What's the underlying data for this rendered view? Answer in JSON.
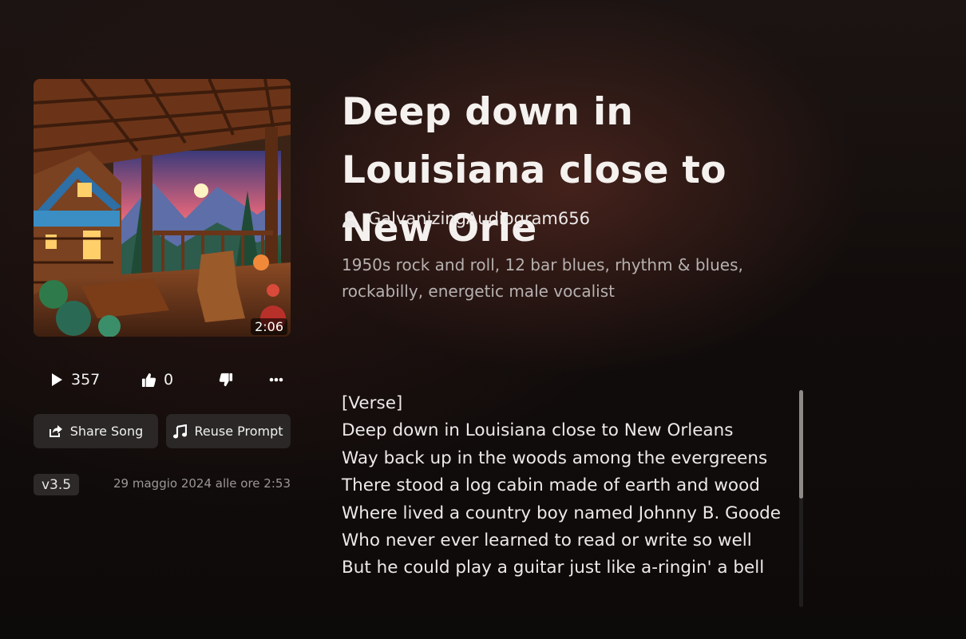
{
  "song": {
    "title": "Deep down in Louisiana close to New Orle",
    "author": "GalvanizingAudiogram656",
    "tags": "1950s rock and roll, 12 bar blues, rhythm & blues, rockabilly, energetic male vocalist",
    "duration": "2:06",
    "cover_icon": "cabin-porch-artwork"
  },
  "stats": {
    "plays": "357",
    "likes": "0"
  },
  "actions": {
    "share_label": "Share Song",
    "reuse_label": "Reuse Prompt"
  },
  "meta": {
    "version": "v3.5",
    "date": "29 maggio 2024 alle ore 2:53"
  },
  "lyrics": [
    "[Verse]",
    "Deep down in Louisiana close to New Orleans",
    "Way back up in the woods among the evergreens",
    "There stood a log cabin made of earth and wood",
    "Where lived a country boy named Johnny B. Goode",
    "Who never ever learned to read or write so well",
    "But he could play a guitar just like a-ringin' a bell"
  ],
  "colors": {
    "accent": "#f4f1ef",
    "button_bg": "#2a2726",
    "muted_text": "#9b9797"
  }
}
